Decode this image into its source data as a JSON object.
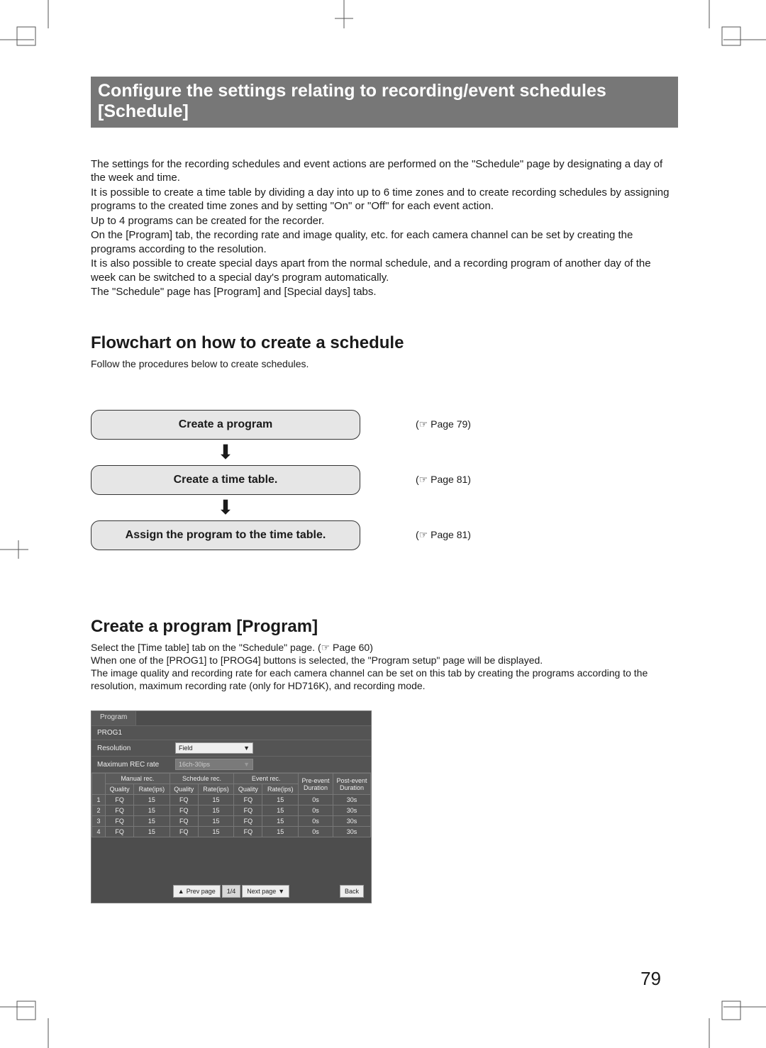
{
  "title": "Configure the settings relating to recording/event schedules [Schedule]",
  "intro_paragraphs": [
    "The settings for the recording schedules and event actions are performed on the \"Schedule\" page by designating a day of the week and time.",
    "It is possible to create a time table by dividing a day into up to 6 time zones and to create recording schedules by assigning programs to the created time zones and by setting \"On\" or \"Off\" for each event action.",
    "Up to 4 programs can be created for the recorder.",
    "On the [Program] tab, the recording rate and image quality, etc. for each camera channel can be set by creating the programs according to the resolution.",
    "It is also possible to create special days apart from the normal schedule, and a recording program of another day of the week can be switched to a special day's program automatically.",
    "The \"Schedule\" page has [Program] and [Special days] tabs."
  ],
  "flowchart": {
    "heading": "Flowchart on how to create a schedule",
    "intro": "Follow the procedures below to create schedules.",
    "steps": [
      {
        "label": "Create a program",
        "ref": "(☞ Page 79)"
      },
      {
        "label": "Create a time table.",
        "ref": "(☞ Page 81)"
      },
      {
        "label": "Assign the program to the time table.",
        "ref": "(☞ Page 81)"
      }
    ]
  },
  "program_section": {
    "heading": "Create a program [Program]",
    "paragraphs": [
      "Select the [Time table] tab on the \"Schedule\" page. (☞ Page 60)",
      "When one of the [PROG1] to [PROG4] buttons is selected, the \"Program setup\" page will be displayed.",
      "The image quality and recording rate for each camera channel can be set on this tab by creating the programs according to the resolution, maximum recording rate (only for HD716K), and recording mode."
    ]
  },
  "panel": {
    "tab_label": "Program",
    "prog_name": "PROG1",
    "resolution_label": "Resolution",
    "resolution_value": "Field",
    "maxrate_label": "Maximum REC rate",
    "maxrate_value": "16ch-30ips",
    "col_groups": {
      "manual": "Manual rec.",
      "schedule": "Schedule rec.",
      "event": "Event rec.",
      "pre": "Pre-event Duration",
      "post": "Post-event Duration"
    },
    "sub_cols": {
      "quality": "Quality",
      "rate": "Rate(ips)"
    },
    "rows": [
      {
        "idx": "1",
        "mq": "FQ",
        "mr": "15",
        "sq": "FQ",
        "sr": "15",
        "eq": "FQ",
        "er": "15",
        "pre": "0s",
        "post": "30s"
      },
      {
        "idx": "2",
        "mq": "FQ",
        "mr": "15",
        "sq": "FQ",
        "sr": "15",
        "eq": "FQ",
        "er": "15",
        "pre": "0s",
        "post": "30s"
      },
      {
        "idx": "3",
        "mq": "FQ",
        "mr": "15",
        "sq": "FQ",
        "sr": "15",
        "eq": "FQ",
        "er": "15",
        "pre": "0s",
        "post": "30s"
      },
      {
        "idx": "4",
        "mq": "FQ",
        "mr": "15",
        "sq": "FQ",
        "sr": "15",
        "eq": "FQ",
        "er": "15",
        "pre": "0s",
        "post": "30s"
      }
    ],
    "footer": {
      "prev": "Prev page",
      "page_indicator": "1/4",
      "next": "Next page",
      "back": "Back"
    }
  },
  "page_number": "79"
}
